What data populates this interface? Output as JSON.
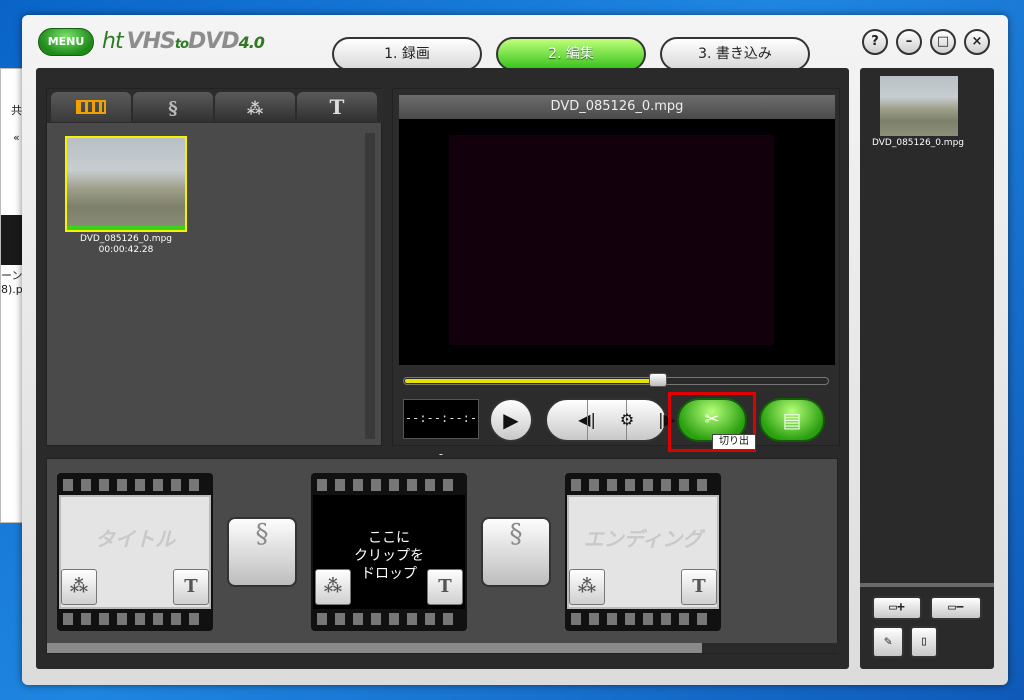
{
  "desktop": {
    "frag1": "共",
    "frag2": "«",
    "frag3": "ーンジ",
    "frag4": "8).p"
  },
  "app": {
    "menu_label": "MENU",
    "logo": {
      "ht": "ht",
      "vhs": "VHS",
      "to": "to",
      "dvd": "DVD",
      "ver": "4.0"
    },
    "steps": [
      {
        "label": "1. 録画",
        "active": false
      },
      {
        "label": "2. 編集",
        "active": true
      },
      {
        "label": "3. 書き込み",
        "active": false
      }
    ],
    "window_buttons": {
      "help": "?",
      "minimize": "–",
      "maximize": "□",
      "close": "×"
    }
  },
  "library": {
    "tabs": [
      {
        "name": "clips",
        "icon": "film-icon"
      },
      {
        "name": "transitions",
        "icon": "transition-icon"
      },
      {
        "name": "effects",
        "icon": "magic-wand-icon"
      },
      {
        "name": "titles",
        "icon": "text-icon",
        "label": "T"
      }
    ],
    "clip": {
      "filename": "DVD_085126_0.mpg",
      "duration": "00:00:42.28"
    }
  },
  "preview": {
    "title": "DVD_085126_0.mpg",
    "timecode": "--:--:--:--",
    "seek_position": 0.6,
    "tooltip": "切り出"
  },
  "storyboard": {
    "title_slot": "タイトル",
    "drop_slot": "ここに\nクリップを\nドロップ",
    "ending_slot": "エンディング",
    "text_icon_label": "T"
  },
  "sidebar": {
    "clip_name": "DVD_085126_0.mpg"
  },
  "colors": {
    "accent_green": "#36c21a",
    "highlight": "#e00000",
    "seek_fill": "#e9e100"
  }
}
